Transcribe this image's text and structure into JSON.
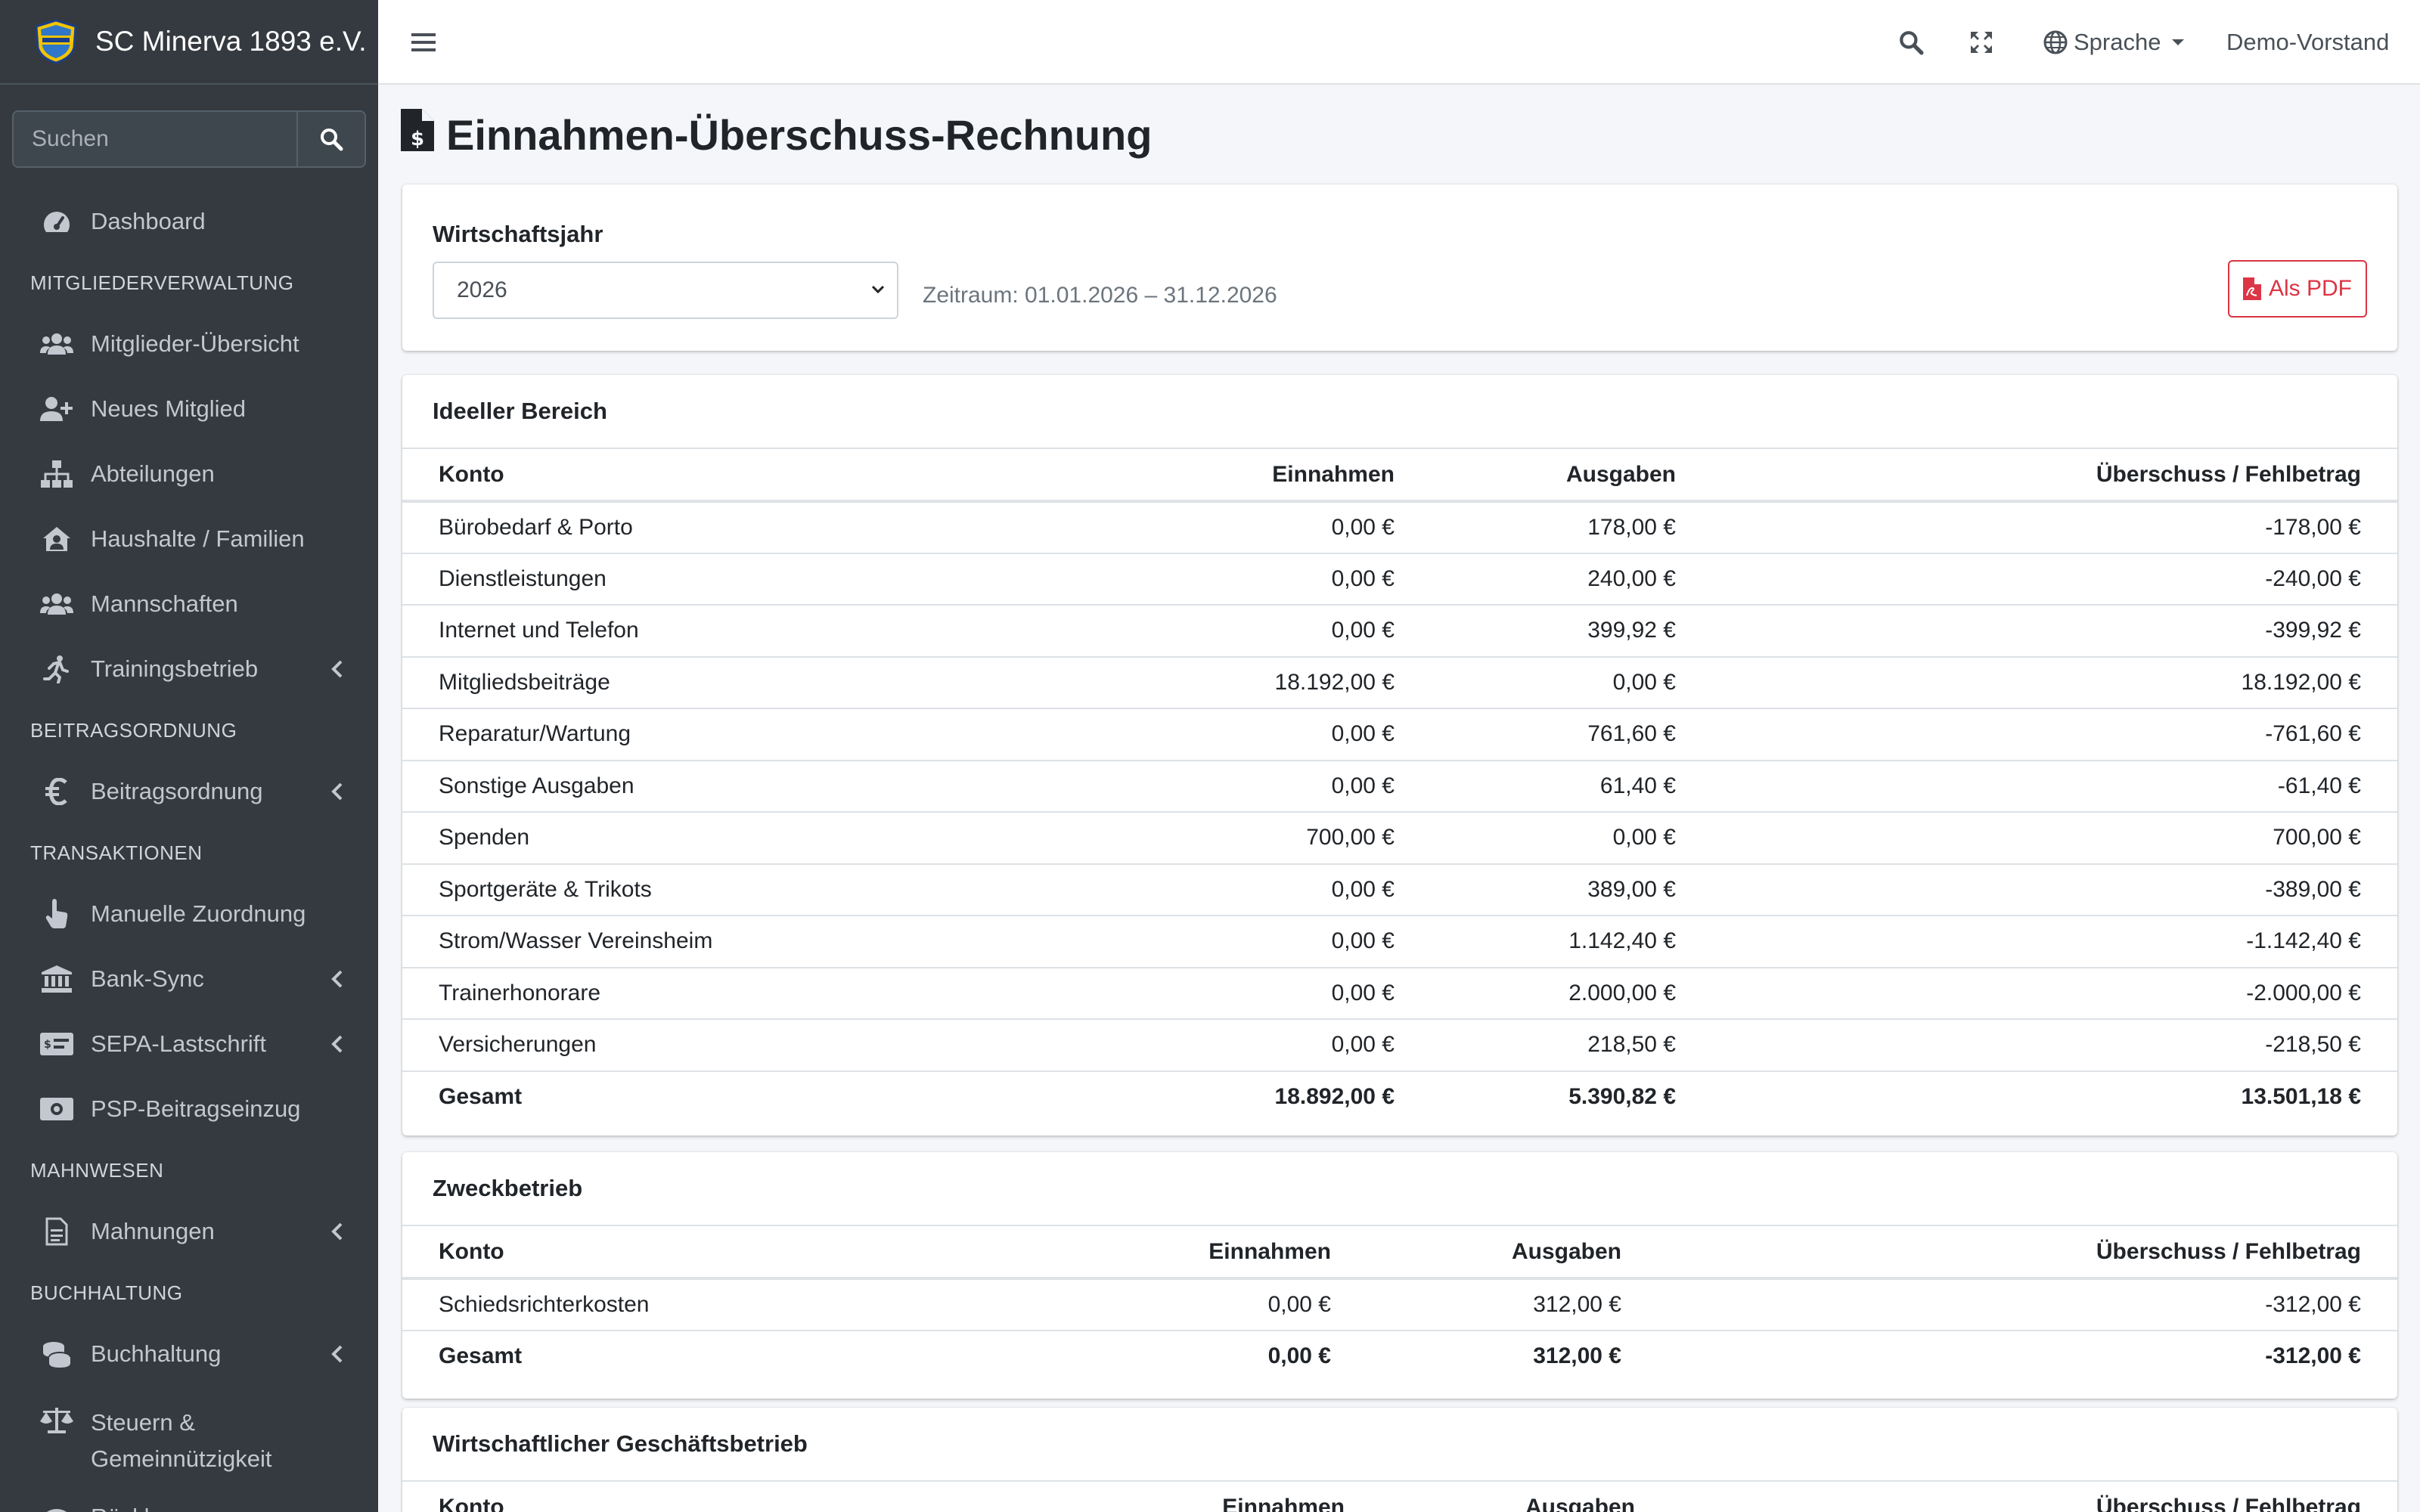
{
  "app": {
    "name": "SC Minerva 1893 e.V."
  },
  "sidebar": {
    "search_placeholder": "Suchen",
    "items": [
      {
        "type": "item",
        "label": "Dashboard",
        "icon": "tachometer-icon"
      },
      {
        "type": "header",
        "label": "MITGLIEDERVERWALTUNG"
      },
      {
        "type": "item",
        "label": "Mitglieder-Übersicht",
        "icon": "users-icon"
      },
      {
        "type": "item",
        "label": "Neues Mitglied",
        "icon": "user-plus-icon"
      },
      {
        "type": "item",
        "label": "Abteilungen",
        "icon": "sitemap-icon"
      },
      {
        "type": "item",
        "label": "Haushalte / Familien",
        "icon": "house-user-icon"
      },
      {
        "type": "item",
        "label": "Mannschaften",
        "icon": "users-icon"
      },
      {
        "type": "item",
        "label": "Trainingsbetrieb",
        "icon": "running-icon",
        "has_children": true
      },
      {
        "type": "header",
        "label": "BEITRAGSORDNUNG"
      },
      {
        "type": "item",
        "label": "Beitragsordnung",
        "icon": "euro-icon",
        "has_children": true
      },
      {
        "type": "header",
        "label": "TRANSAKTIONEN"
      },
      {
        "type": "item",
        "label": "Manuelle Zuordnung",
        "icon": "hand-pointer-icon"
      },
      {
        "type": "item",
        "label": "Bank-Sync",
        "icon": "bank-icon",
        "has_children": true
      },
      {
        "type": "item",
        "label": "SEPA-Lastschrift",
        "icon": "money-check-icon",
        "has_children": true
      },
      {
        "type": "item",
        "label": "PSP-Beitragseinzug",
        "icon": "money-bill-icon"
      },
      {
        "type": "header",
        "label": "MAHNWESEN"
      },
      {
        "type": "item",
        "label": "Mahnungen",
        "icon": "file-icon",
        "has_children": true
      },
      {
        "type": "header",
        "label": "BUCHHALTUNG"
      },
      {
        "type": "item",
        "label": "Buchhaltung",
        "icon": "coins-icon",
        "has_children": true
      },
      {
        "type": "item",
        "label": "Steuern & Gemeinnützigkeit",
        "icon": "balance-scale-icon"
      },
      {
        "type": "item",
        "label": "Rücklagen",
        "icon": "piggy-bank-icon"
      }
    ]
  },
  "topbar": {
    "language_label": "Sprache",
    "user_label": "Demo-Vorstand"
  },
  "page": {
    "title": "Einnahmen-Überschuss-Rechnung"
  },
  "filter": {
    "label": "Wirtschaftsjahr",
    "selected_year": "2026",
    "zeitraum": "Zeitraum: 01.01.2026 – 31.12.2026",
    "pdf_label": "Als PDF"
  },
  "columns": {
    "konto": "Konto",
    "einnahmen": "Einnahmen",
    "ausgaben": "Ausgaben",
    "ueberschuss": "Überschuss / Fehlbetrag"
  },
  "sections": {
    "ideell": {
      "title": "Ideeller Bereich",
      "rows": [
        [
          "Bürobedarf & Porto",
          "0,00 €",
          "178,00 €",
          "-178,00 €"
        ],
        [
          "Dienstleistungen",
          "0,00 €",
          "240,00 €",
          "-240,00 €"
        ],
        [
          "Internet und Telefon",
          "0,00 €",
          "399,92 €",
          "-399,92 €"
        ],
        [
          "Mitgliedsbeiträge",
          "18.192,00 €",
          "0,00 €",
          "18.192,00 €"
        ],
        [
          "Reparatur/Wartung",
          "0,00 €",
          "761,60 €",
          "-761,60 €"
        ],
        [
          "Sonstige Ausgaben",
          "0,00 €",
          "61,40 €",
          "-61,40 €"
        ],
        [
          "Spenden",
          "700,00 €",
          "0,00 €",
          "700,00 €"
        ],
        [
          "Sportgeräte & Trikots",
          "0,00 €",
          "389,00 €",
          "-389,00 €"
        ],
        [
          "Strom/Wasser Vereinsheim",
          "0,00 €",
          "1.142,40 €",
          "-1.142,40 €"
        ],
        [
          "Trainerhonorare",
          "0,00 €",
          "2.000,00 €",
          "-2.000,00 €"
        ],
        [
          "Versicherungen",
          "0,00 €",
          "218,50 €",
          "-218,50 €"
        ]
      ],
      "total": [
        "Gesamt",
        "18.892,00 €",
        "5.390,82 €",
        "13.501,18 €"
      ]
    },
    "zweck": {
      "title": "Zweckbetrieb",
      "rows": [
        [
          "Schiedsrichterkosten",
          "0,00 €",
          "312,00 €",
          "-312,00 €"
        ]
      ],
      "total": [
        "Gesamt",
        "0,00 €",
        "312,00 €",
        "-312,00 €"
      ]
    },
    "wirtschaft": {
      "title": "Wirtschaftlicher Geschäftsbetrieb"
    }
  }
}
